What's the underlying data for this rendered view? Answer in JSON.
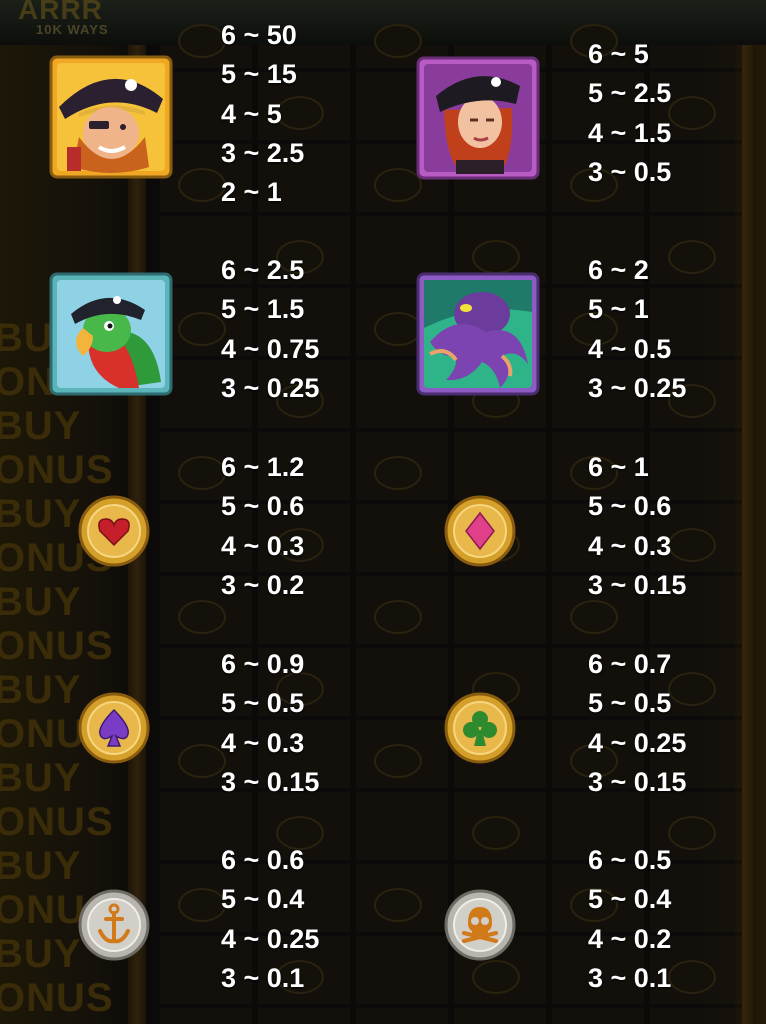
{
  "background": {
    "logo_text": "ARRR",
    "logo_sub": "10K WAYS",
    "side_words": [
      "BU",
      "ONUS",
      "BUY",
      "ONUS",
      "BUY",
      "ONUS",
      "BUY",
      "ONUS",
      "BUY",
      "ONUS",
      "BUY",
      "ONUS",
      "BUY",
      "ONUS",
      "BUY",
      "ONUS"
    ]
  },
  "paytable": [
    {
      "symbol": "pirate-captain",
      "icon": "pirate-captain-icon",
      "frame": "#c9a23a",
      "pays": [
        "6 ~ 50",
        "5 ~ 15",
        "4 ~ 5",
        "3 ~ 2.5",
        "2 ~ 1"
      ]
    },
    {
      "symbol": "pirate-woman",
      "icon": "pirate-woman-icon",
      "frame": "#b85cc4",
      "pays": [
        "6 ~ 5",
        "5 ~ 2.5",
        "4 ~ 1.5",
        "3 ~ 0.5"
      ]
    },
    {
      "symbol": "parrot",
      "icon": "parrot-icon",
      "frame": "#5bb4b8",
      "pays": [
        "6 ~ 2.5",
        "5 ~ 1.5",
        "4 ~ 0.75",
        "3 ~ 0.25"
      ]
    },
    {
      "symbol": "octopus",
      "icon": "octopus-icon",
      "frame": "#8c5cc4",
      "pays": [
        "6 ~ 2",
        "5 ~ 1",
        "4 ~ 0.5",
        "3 ~ 0.25"
      ]
    },
    {
      "symbol": "heart-coin",
      "icon": "heart-coin-icon",
      "frame": "#d4a02a",
      "suit_color": "#c41f2a",
      "pays": [
        "6 ~ 1.2",
        "5 ~ 0.6",
        "4 ~ 0.3",
        "3 ~ 0.2"
      ]
    },
    {
      "symbol": "diamond-coin",
      "icon": "diamond-coin-icon",
      "frame": "#d4a02a",
      "suit_color": "#e0408a",
      "pays": [
        "6 ~ 1",
        "5 ~ 0.6",
        "4 ~ 0.3",
        "3 ~ 0.15"
      ]
    },
    {
      "symbol": "spade-coin",
      "icon": "spade-coin-icon",
      "frame": "#d4a02a",
      "suit_color": "#7a3cc4",
      "pays": [
        "6 ~ 0.9",
        "5 ~ 0.5",
        "4 ~ 0.3",
        "3 ~ 0.15"
      ]
    },
    {
      "symbol": "club-coin",
      "icon": "club-coin-icon",
      "frame": "#d4a02a",
      "suit_color": "#2e8a2e",
      "pays": [
        "6 ~ 0.7",
        "5 ~ 0.5",
        "4 ~ 0.25",
        "3 ~ 0.15"
      ]
    },
    {
      "symbol": "anchor-coin",
      "icon": "anchor-coin-icon",
      "frame": "#b8b4ae",
      "suit_color": "#d07a1a",
      "pays": [
        "6 ~ 0.6",
        "5 ~ 0.4",
        "4 ~ 0.25",
        "3 ~ 0.1"
      ]
    },
    {
      "symbol": "skull-coin",
      "icon": "skull-coin-icon",
      "frame": "#b8b4ae",
      "suit_color": "#d07a1a",
      "pays": [
        "6 ~ 0.5",
        "5 ~ 0.4",
        "4 ~ 0.2",
        "3 ~ 0.1"
      ]
    }
  ]
}
